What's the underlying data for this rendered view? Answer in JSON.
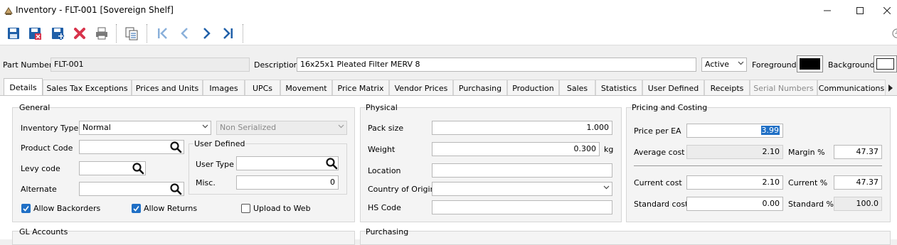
{
  "window": {
    "title": "Inventory - FLT-001 [Sovereign Shelf]"
  },
  "toolbar": {
    "buttons": [
      "save-icon",
      "save-close-icon",
      "save-new-icon",
      "delete-icon",
      "print-icon",
      "copy-icon",
      "first-record-icon",
      "previous-record-icon",
      "next-record-icon",
      "last-record-icon"
    ]
  },
  "header": {
    "part_number_label": "Part Number",
    "part_number": "FLT-001",
    "description_label": "Description",
    "description": "16x25x1 Pleated Filter MERV 8",
    "status": "Active",
    "foreground_label": "Foreground",
    "foreground_color": "#000000",
    "background_label": "Background",
    "background_color": "#ffffff"
  },
  "tabs": [
    "Details",
    "Sales Tax Exceptions",
    "Prices and Units",
    "Images",
    "UPCs",
    "Movement",
    "Price Matrix",
    "Vendor Prices",
    "Purchasing",
    "Production",
    "Sales",
    "Statistics",
    "User Defined",
    "Receipts",
    "Serial Numbers",
    "Communications"
  ],
  "general": {
    "title": "General",
    "inventory_type_label": "Inventory Type",
    "inventory_type": "Normal",
    "serial_type": "Non Serialized",
    "product_code_label": "Product Code",
    "levy_code_label": "Levy code",
    "alternate_label": "Alternate",
    "user_defined_title": "User Defined",
    "user_type_label": "User Type",
    "misc_label": "Misc.",
    "misc_value": "0",
    "allow_backorders_label": "Allow Backorders",
    "allow_returns_label": "Allow Returns",
    "upload_to_web_label": "Upload to Web"
  },
  "physical": {
    "title": "Physical",
    "pack_size_label": "Pack size",
    "pack_size": "1.000",
    "weight_label": "Weight",
    "weight": "0.300",
    "weight_unit": "kg",
    "location_label": "Location",
    "country_label": "Country of Origin",
    "hs_code_label": "HS Code"
  },
  "pricing": {
    "title": "Pricing and Costing",
    "price_label": "Price per EA",
    "price": "3.99",
    "average_cost_label": "Average cost",
    "average_cost": "2.10",
    "margin_label": "Margin %",
    "margin": "47.37",
    "current_cost_label": "Current cost",
    "current_cost": "2.10",
    "current_pct_label": "Current %",
    "current_pct": "47.37",
    "standard_cost_label": "Standard cost",
    "standard_cost": "0.00",
    "standard_pct_label": "Standard %",
    "standard_pct": "100.0"
  },
  "lower": {
    "gl_accounts_title": "GL Accounts",
    "purchasing_title": "Purchasing"
  }
}
